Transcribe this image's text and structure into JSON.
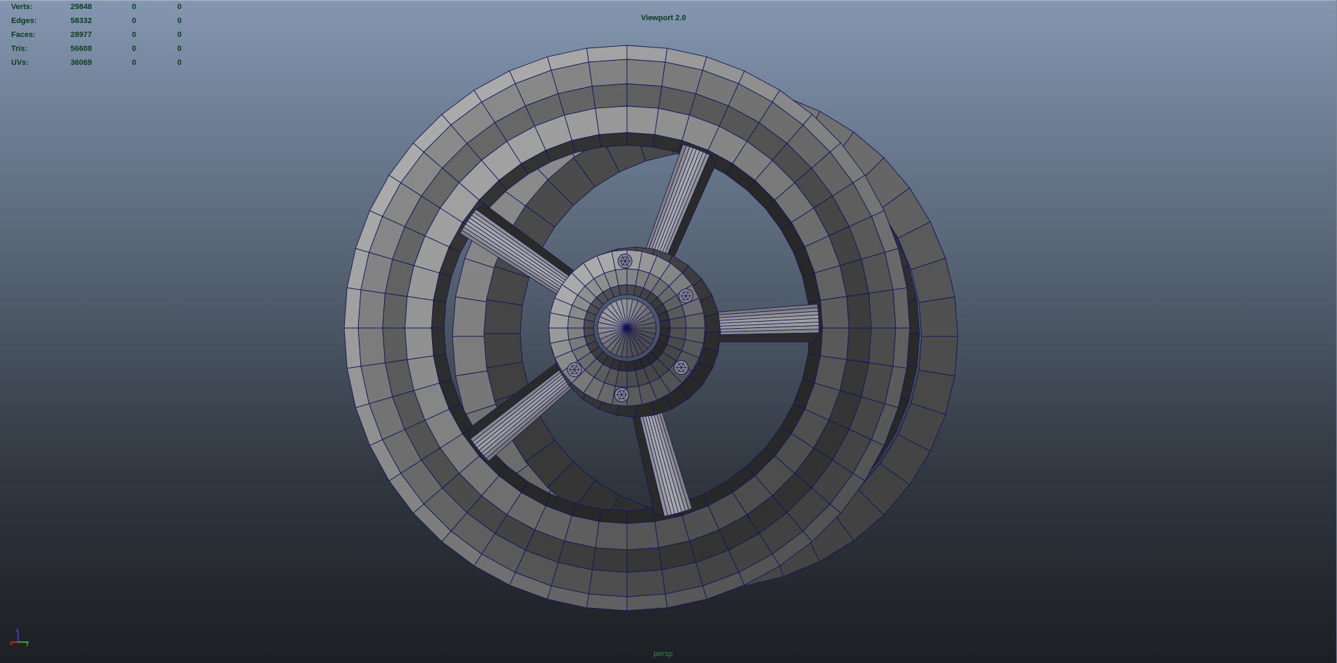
{
  "viewport": {
    "title": "Viewport 2.0",
    "camera": "persp"
  },
  "hud_stats": [
    {
      "label": "Verts:",
      "value": "29848",
      "col2": "0",
      "col3": "0"
    },
    {
      "label": "Edges:",
      "value": "58332",
      "col2": "0",
      "col3": "0"
    },
    {
      "label": "Faces:",
      "value": "28977",
      "col2": "0",
      "col3": "0"
    },
    {
      "label": "Tris:",
      "value": "56608",
      "col2": "0",
      "col3": "0"
    },
    {
      "label": "UVs:",
      "value": "36069",
      "col2": "0",
      "col3": "0"
    }
  ],
  "axis_gizmo": {
    "x": "x",
    "y": "y",
    "z": "z"
  },
  "colors": {
    "wire": "#14145a",
    "face_light": "#8a8a8a",
    "face_dark": "#3e3e3e",
    "hud_text": "#0a3d1e",
    "camera_text": "#2c8a45"
  },
  "icons": [
    "axis-gizmo-icon"
  ]
}
